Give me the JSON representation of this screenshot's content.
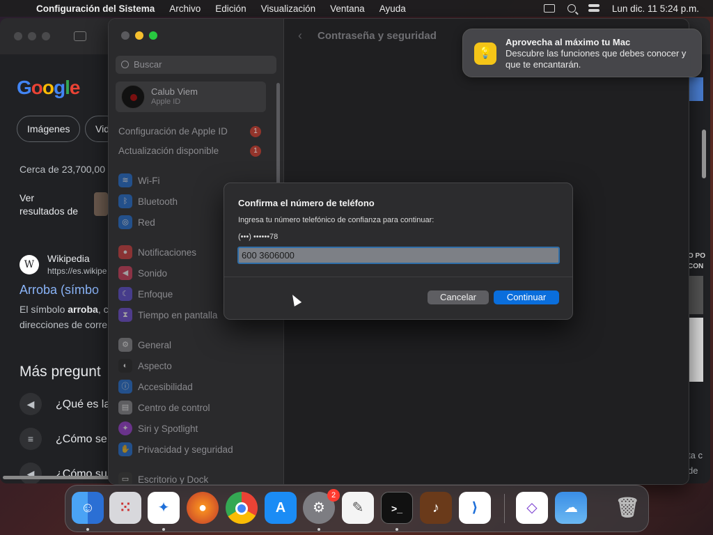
{
  "menubar": {
    "app": "Configuración del Sistema",
    "items": [
      "Archivo",
      "Edición",
      "Visualización",
      "Ventana",
      "Ayuda"
    ],
    "clock": "Lun dic. 11  5:24 p.m."
  },
  "browser": {
    "logo": [
      "G",
      "o",
      "o",
      "g",
      "l",
      "e"
    ],
    "chips": [
      "Imágenes",
      "Vid"
    ],
    "results_count": "Cerca de 23,700,00",
    "see_results": [
      "Ver",
      "resultados de"
    ],
    "wiki_site": "Wikipedia",
    "wiki_url": "https://es.wikipe",
    "wiki_title": "Arroba (símbo",
    "wiki_snippet_1_pre": "El símbolo ",
    "wiki_snippet_1_bold": "arroba",
    "wiki_snippet_1_post": ", c",
    "wiki_snippet_2": "direcciones de corre",
    "more_questions": "Más pregunt",
    "faqs": [
      "¿Qué es la",
      "¿Cómo se",
      "¿Cómo su"
    ],
    "right_text_1": "O PO",
    "right_text_2": "CON",
    "right_text_3": "ta c",
    "right_text_4": "de"
  },
  "settings": {
    "search_placeholder": "Buscar",
    "user_name": "Calub Viem",
    "user_sub": "Apple ID",
    "rows": [
      {
        "label": "Configuración de Apple ID",
        "badge": "1"
      },
      {
        "label": "Actualización disponible",
        "badge": "1"
      }
    ],
    "items": [
      {
        "label": "Wi-Fi",
        "icon": "wifi-icon",
        "color": "#1e6fd9"
      },
      {
        "label": "Bluetooth",
        "icon": "bluetooth-icon",
        "color": "#1e6fd9"
      },
      {
        "label": "Red",
        "icon": "globe-icon",
        "color": "#1e6fd9"
      },
      {
        "label": "Notificaciones",
        "icon": "bell-icon",
        "color": "#d93b3b"
      },
      {
        "label": "Sonido",
        "icon": "speaker-icon",
        "color": "#d93b5a"
      },
      {
        "label": "Enfoque",
        "icon": "moon-icon",
        "color": "#5e4bd9"
      },
      {
        "label": "Tiempo en pantalla",
        "icon": "hourglass-icon",
        "color": "#6e4bd9"
      },
      {
        "label": "General",
        "icon": "gear-icon",
        "color": "#8a8a8e"
      },
      {
        "label": "Aspecto",
        "icon": "appearance-icon",
        "color": "#222222"
      },
      {
        "label": "Accesibilidad",
        "icon": "accessibility-icon",
        "color": "#1e6fd9"
      },
      {
        "label": "Centro de control",
        "icon": "control-center-icon",
        "color": "#8a8a8e"
      },
      {
        "label": "Siri y Spotlight",
        "icon": "siri-icon",
        "color": "#a03bd9"
      },
      {
        "label": "Privacidad y seguridad",
        "icon": "hand-icon",
        "color": "#1e6fd9"
      },
      {
        "label": "Escritorio y Dock",
        "icon": "desktop-icon",
        "color": "#333333"
      }
    ],
    "content_title": "Contraseña y seguridad"
  },
  "notification": {
    "title": "Aprovecha al máximo tu Mac",
    "body": "Descubre las funciones que debes conocer y que te encantarán."
  },
  "dialog": {
    "title": "Confirma el número de teléfono",
    "message": "Ingresa tu número telefónico de confianza para continuar:",
    "hint": "(•••) ••••••78",
    "input_value": "600 3606000",
    "cancel": "Cancelar",
    "continue": "Continuar",
    "accent": "#0a6edc"
  },
  "dock": {
    "badge": "2",
    "apps": [
      "finder-icon",
      "launchpad-icon",
      "safari-icon",
      "firefox-icon",
      "chrome-icon",
      "app-store-icon",
      "system-settings-icon",
      "textedit-icon",
      "terminal-icon",
      "garageband-icon",
      "vscode-icon",
      "visual-studio-icon",
      "weather-icon",
      "trash-icon"
    ]
  }
}
